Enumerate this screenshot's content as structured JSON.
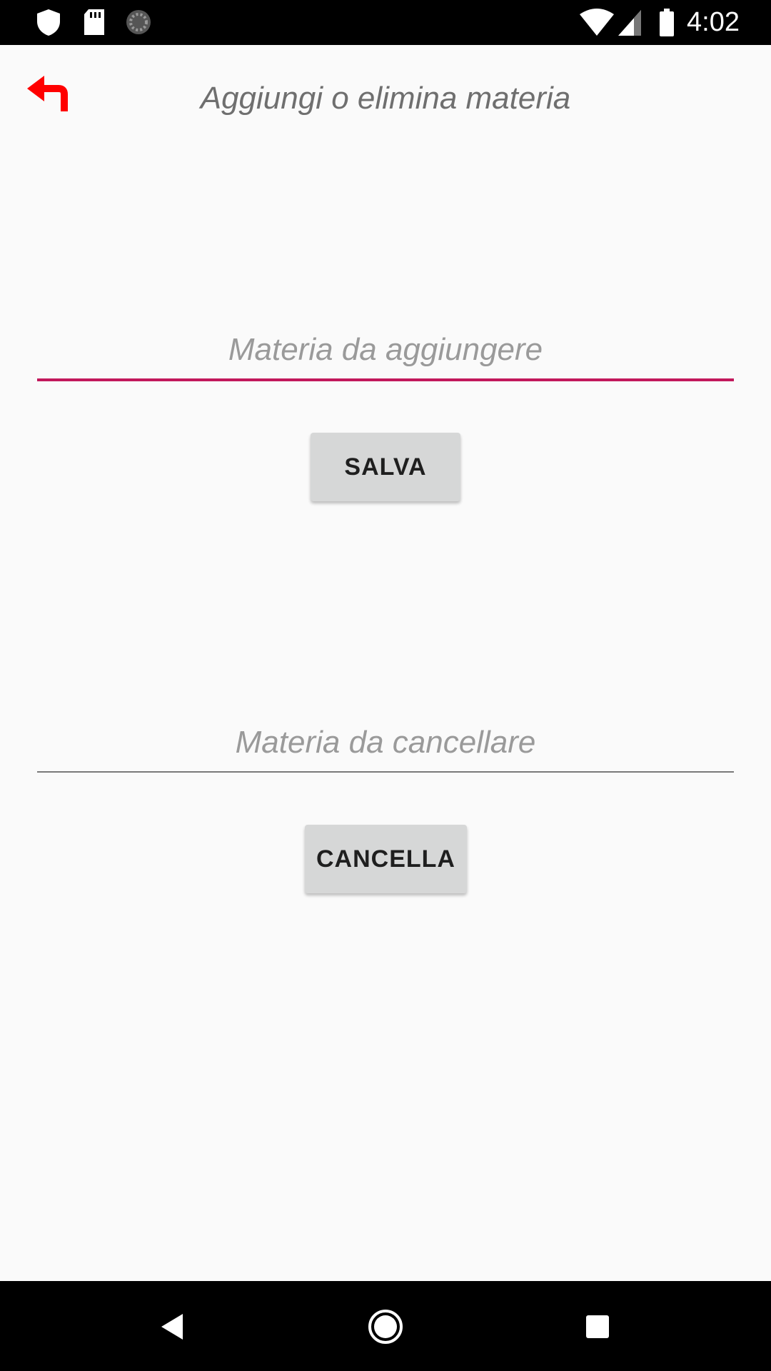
{
  "status_bar": {
    "time": "4:02",
    "left_icons": [
      "shield-icon",
      "sd-card-icon",
      "sync-icon"
    ],
    "right_icons": [
      "wifi-icon",
      "signal-icon",
      "battery-icon"
    ]
  },
  "header": {
    "back_icon": "back-arrow-icon",
    "title": "Aggiungi o elimina materia"
  },
  "add_section": {
    "placeholder": "Materia da aggiungere",
    "value": "",
    "button_label": "SALVA"
  },
  "delete_section": {
    "placeholder": "Materia da cancellare",
    "value": "",
    "button_label": "CANCELLA"
  },
  "nav_bar": {
    "buttons": [
      "back-triangle-icon",
      "home-circle-icon",
      "recents-square-icon"
    ]
  },
  "colors": {
    "accent": "#c2185b",
    "back_arrow": "#ff0000",
    "button_bg": "#d6d7d7",
    "background": "#fafafa"
  }
}
